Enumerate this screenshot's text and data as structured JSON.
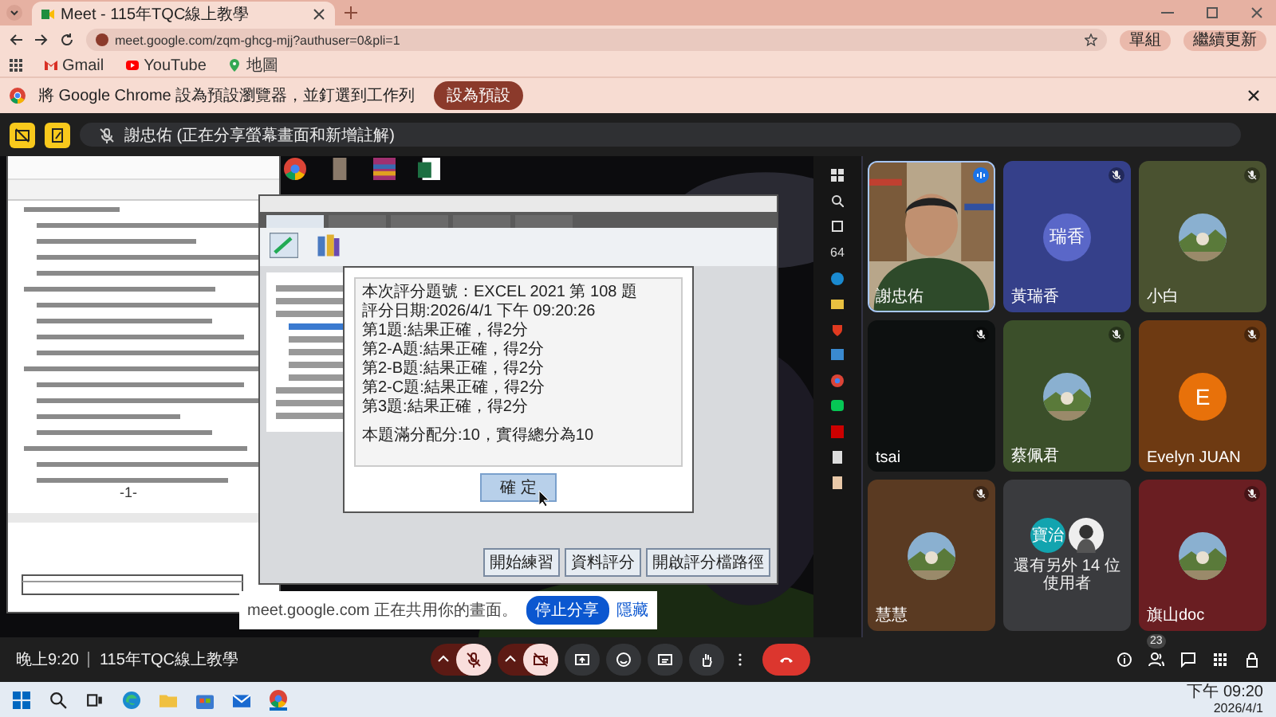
{
  "browser": {
    "tab": {
      "title": "Meet - 115年TQC線上教學"
    },
    "url": "meet.google.com/zqm-ghcg-mjj?authuser=0&pli=1",
    "profile": "單組",
    "update": "繼續更新",
    "bookmarks": [
      {
        "label": "Gmail",
        "kind": "gmail"
      },
      {
        "label": "YouTube",
        "kind": "youtube"
      },
      {
        "label": "地圖",
        "kind": "maps"
      }
    ],
    "infobar": {
      "text": "將 Google Chrome 設為預設瀏覽器，並釘選到工作列",
      "button": "設為預設"
    }
  },
  "presenter_bar": {
    "text": "謝忠佑 (正在分享螢幕畫面和新增註解)"
  },
  "shared_screen": {
    "dialog": {
      "lines": [
        {
          "text": "本次評分題號：EXCEL 2021 第 108 題",
          "kind": "result"
        },
        {
          "text": "評分日期:2026/4/1 下午 09:20:26",
          "kind": "result"
        },
        {
          "text": "第1題:結果正確，得2分",
          "kind": "result"
        },
        {
          "text": "第2-A題:結果正確，得2分",
          "kind": "result"
        },
        {
          "text": "第2-B題:結果正確，得2分",
          "kind": "result"
        },
        {
          "text": "第2-C題:結果正確，得2分",
          "kind": "result"
        },
        {
          "text": "第3題:結果正確，得2分",
          "kind": "result"
        },
        {
          "text": "本題滿分配分:10，實得總分為10",
          "kind": "total"
        }
      ],
      "button": "確 定"
    },
    "ribbon_tabs": [
      {
        "selected": true
      },
      {
        "selected": false
      },
      {
        "selected": false
      },
      {
        "selected": false
      },
      {
        "selected": false
      }
    ],
    "app_buttons": [
      "開始練習",
      "資料評分",
      "開啟評分檔路徑"
    ],
    "page_number": "-1-",
    "share_bar": {
      "text": "meet.google.com 正在共用你的畫面。",
      "stop": "停止分享",
      "hide": "隱藏"
    },
    "side_taskbar": {
      "label": "64"
    }
  },
  "participants": [
    {
      "name": "謝忠佑",
      "kind": "video",
      "color": "#2f3a2a",
      "muted": false
    },
    {
      "name": "黃瑞香",
      "kind": "initials",
      "initials": "瑞香",
      "color": "#35408a",
      "muted": true
    },
    {
      "name": "小白",
      "color": "#4a5230",
      "muted": true
    },
    {
      "name": "tsai",
      "kind": "blank",
      "color": "#0d1010",
      "muted": true
    },
    {
      "name": "蔡佩君",
      "color": "#3b4f2a",
      "muted": true
    },
    {
      "name": "Evelyn JUAN",
      "kind": "initials",
      "initials": "E",
      "color": "#6e3a12",
      "muted": true
    },
    {
      "name": "慧慧",
      "color": "#5a3a22",
      "muted": true
    },
    {
      "name": "還有另外 14 位使用者",
      "kind": "others",
      "initials": "寶治",
      "color": "#3a3b3e",
      "muted": false
    },
    {
      "name": "旗山doc",
      "color": "#6a1e22",
      "muted": true
    }
  ],
  "controls": {
    "time": "晚上9:20",
    "meeting": "115年TQC線上教學",
    "mic_on": false,
    "camera_on": false,
    "people_count": "23"
  },
  "taskbar": {
    "time": "下午 09:20",
    "date": "2026/4/1"
  }
}
